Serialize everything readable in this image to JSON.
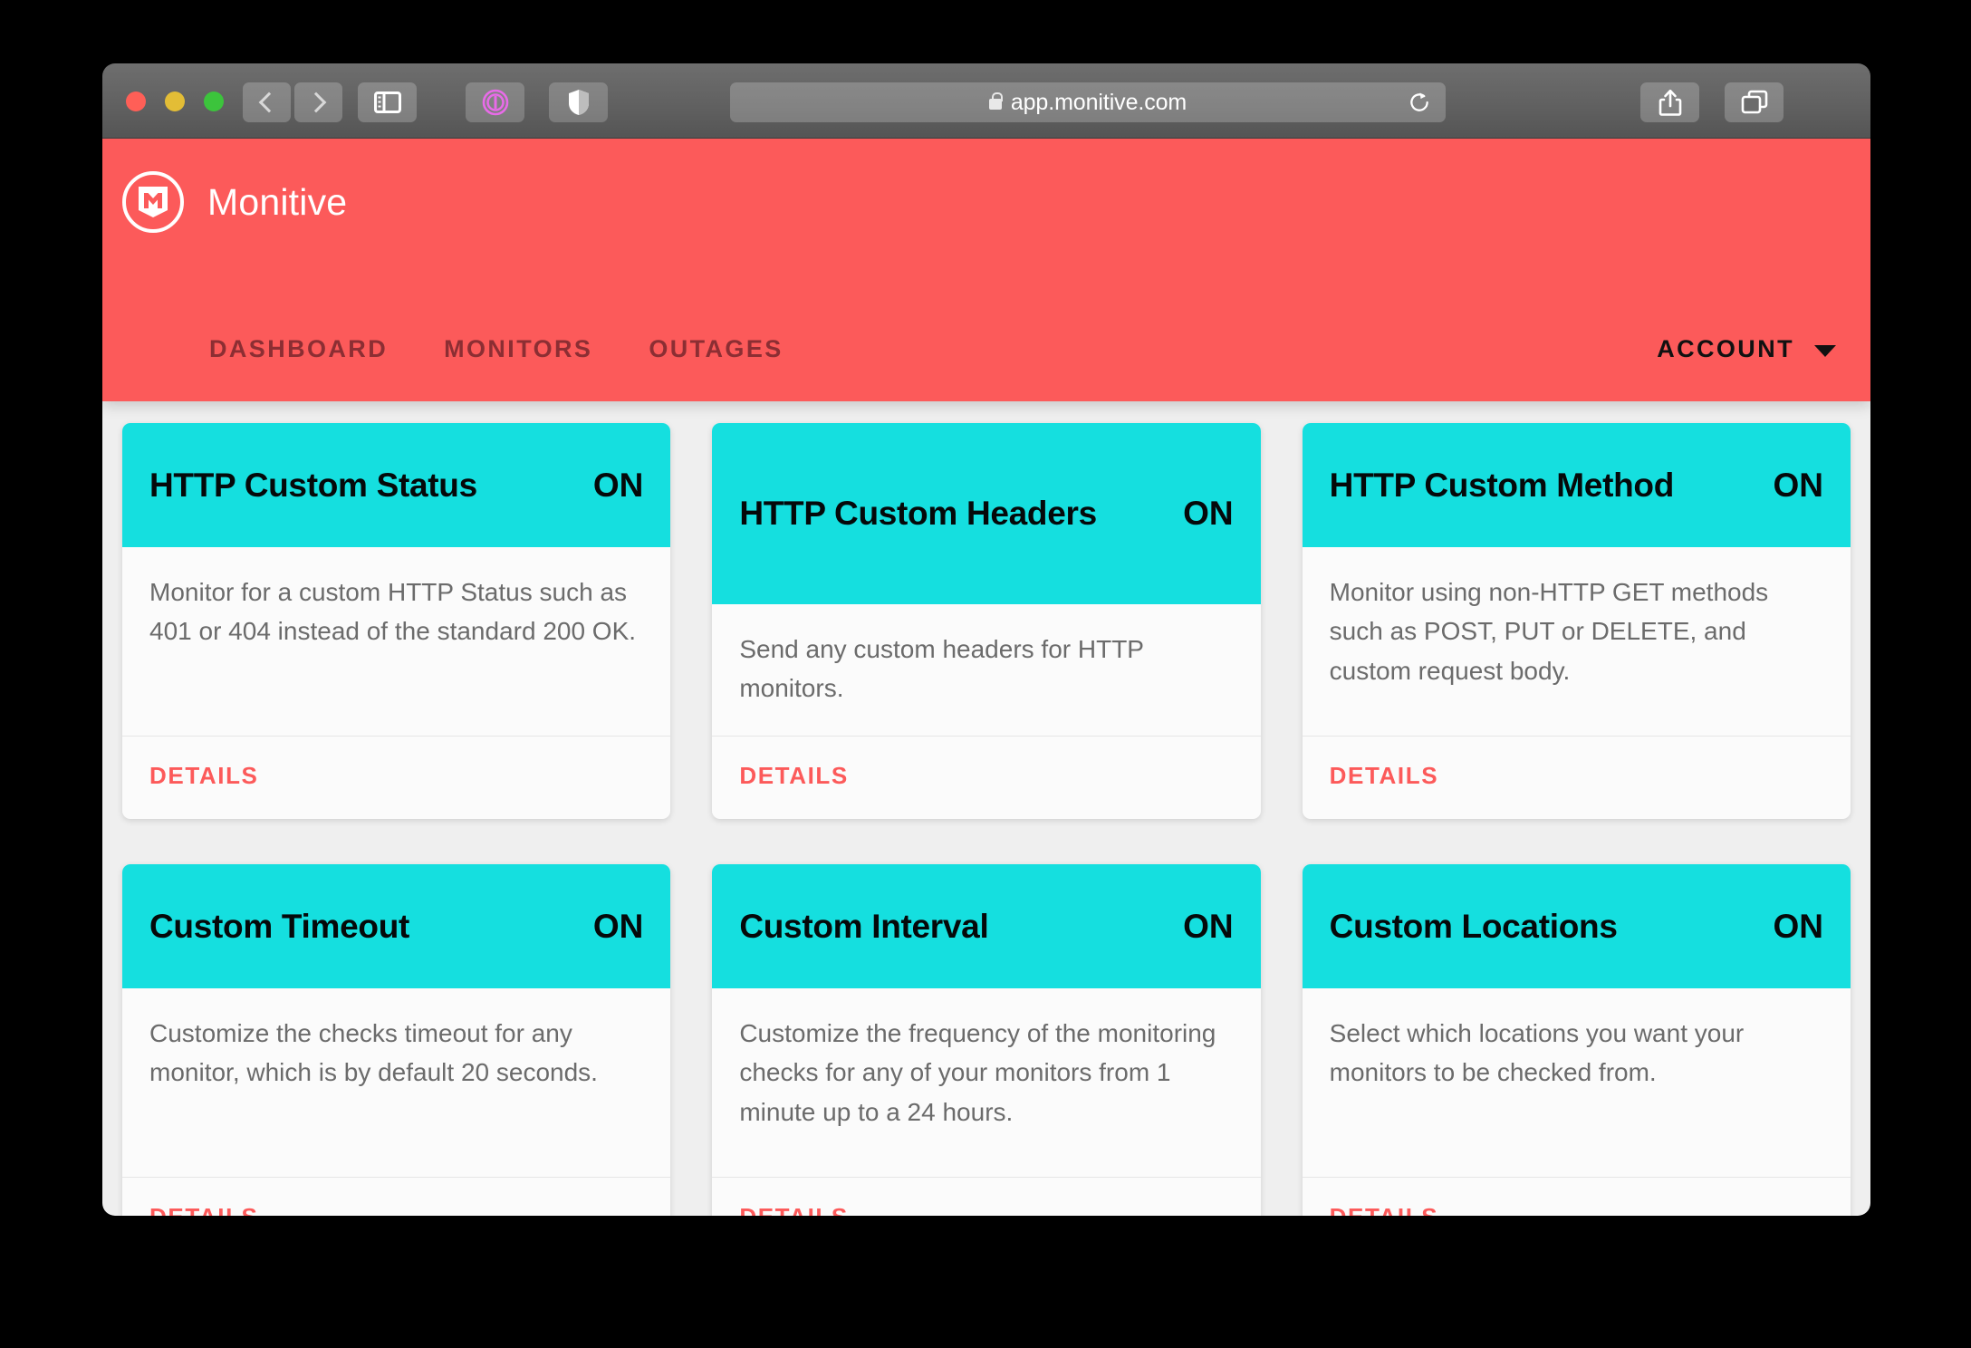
{
  "browser": {
    "url": "app.monitive.com",
    "lock_icon": "lock-icon",
    "back_icon": "chevron-left-icon",
    "forward_icon": "chevron-right-icon",
    "sidebar_icon": "sidebar-toggle-icon",
    "extension_1_icon": "1password-extension-icon",
    "extension_2_icon": "shield-extension-icon",
    "reload_icon": "reload-icon",
    "share_icon": "share-icon",
    "tabs_icon": "tab-overview-icon",
    "new_tab_label": "+",
    "traffic_lights": [
      "close",
      "minimize",
      "zoom"
    ]
  },
  "app": {
    "brand_name": "Monitive",
    "logo_icon": "monitive-m-shield-logo",
    "accent_color": "#fc5a5a",
    "card_header_color": "#15dfdf",
    "nav": [
      {
        "label": "DASHBOARD"
      },
      {
        "label": "MONITORS"
      },
      {
        "label": "OUTAGES"
      }
    ],
    "account": {
      "label": "ACCOUNT",
      "caret_icon": "chevron-down-icon"
    }
  },
  "cards": [
    {
      "title": "HTTP Custom Status",
      "state": "ON",
      "description": "Monitor for a custom HTTP Status such as 401 or 404 instead of the standard 200 OK.",
      "action": "DETAILS",
      "two_line_title": false
    },
    {
      "title": "HTTP Custom Headers",
      "state": "ON",
      "description": "Send any custom headers for HTTP monitors.",
      "action": "DETAILS",
      "two_line_title": true
    },
    {
      "title": "HTTP Custom Method",
      "state": "ON",
      "description": "Monitor using non-HTTP GET methods such as POST, PUT or DELETE, and custom request body.",
      "action": "DETAILS",
      "two_line_title": false
    },
    {
      "title": "Custom Timeout",
      "state": "ON",
      "description": "Customize the checks timeout for any monitor, which is by default 20 seconds.",
      "action": "DETAILS",
      "two_line_title": false
    },
    {
      "title": "Custom Interval",
      "state": "ON",
      "description": "Customize the frequency of the monitoring checks for any of your monitors from 1 minute up to a 24 hours.",
      "action": "DETAILS",
      "two_line_title": false
    },
    {
      "title": "Custom Locations",
      "state": "ON",
      "description": "Select which locations you want your monitors to be checked from.",
      "action": "DETAILS",
      "two_line_title": false
    }
  ]
}
